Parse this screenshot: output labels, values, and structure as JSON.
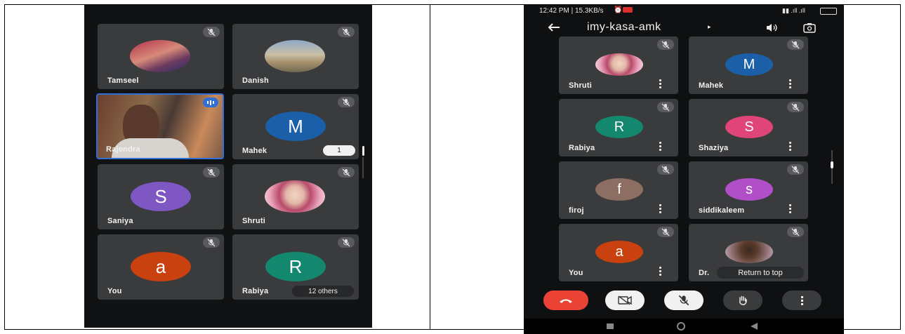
{
  "left_panel": {
    "tiles": [
      {
        "name": "Tamseel"
      },
      {
        "name": "Danish"
      },
      {
        "name": "Rajendra"
      },
      {
        "name": "Mahek",
        "initial": "M",
        "color": "#1a5fa8",
        "badge": "1"
      },
      {
        "name": "Saniya",
        "initial": "S",
        "color": "#7e57c2"
      },
      {
        "name": "Shruti"
      },
      {
        "name": "You",
        "initial": "a",
        "color": "#c9410f"
      },
      {
        "name": "Rabiya",
        "initial": "R",
        "color": "#14876f",
        "others": "12 others"
      }
    ]
  },
  "right_panel": {
    "status_bar": {
      "time": "12:42 PM | 15.3KB/s",
      "right_icons": [
        "alarm-icon",
        "signal-icon",
        "battery-icon"
      ]
    },
    "header": {
      "meeting_code": "imy-kasa-amk",
      "icons": [
        "back-arrow-icon",
        "speaker-icon",
        "switch-camera-icon"
      ]
    },
    "tiles": [
      {
        "name": "Shruti"
      },
      {
        "name": "Mahek",
        "initial": "M",
        "color": "#1a5fa8"
      },
      {
        "name": "Rabiya",
        "initial": "R",
        "color": "#14876f"
      },
      {
        "name": "Shaziya",
        "initial": "S",
        "color": "#e0457a"
      },
      {
        "name": "firoj",
        "initial": "f",
        "color": "#8d6e63"
      },
      {
        "name": "siddikaleem",
        "initial": "s",
        "color": "#b04fc8"
      },
      {
        "name": "You",
        "initial": "a",
        "color": "#c9410f"
      },
      {
        "name": "Dr."
      }
    ],
    "return_to_top": "Return to top",
    "controls": [
      "end-call",
      "camera-off",
      "mic-off",
      "raise-hand",
      "more-options"
    ],
    "accent_end_call": "#ea4335"
  }
}
